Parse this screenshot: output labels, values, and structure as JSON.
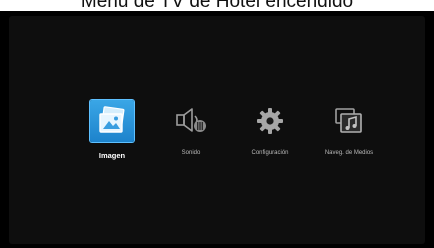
{
  "caption": "Menu de TV de Hotel encendido",
  "menu": {
    "items": [
      {
        "label": "Imagen",
        "icon": "pictures-icon",
        "selected": true
      },
      {
        "label": "Sonido",
        "icon": "speaker-icon",
        "selected": false
      },
      {
        "label": "Configuración",
        "icon": "gear-icon",
        "selected": false
      },
      {
        "label": "Naveg. de Medios",
        "icon": "media-browser-icon",
        "selected": false
      }
    ]
  },
  "colors": {
    "selected_tile": "#2b95da",
    "background": "#000000",
    "label": "#b9b9b9"
  }
}
